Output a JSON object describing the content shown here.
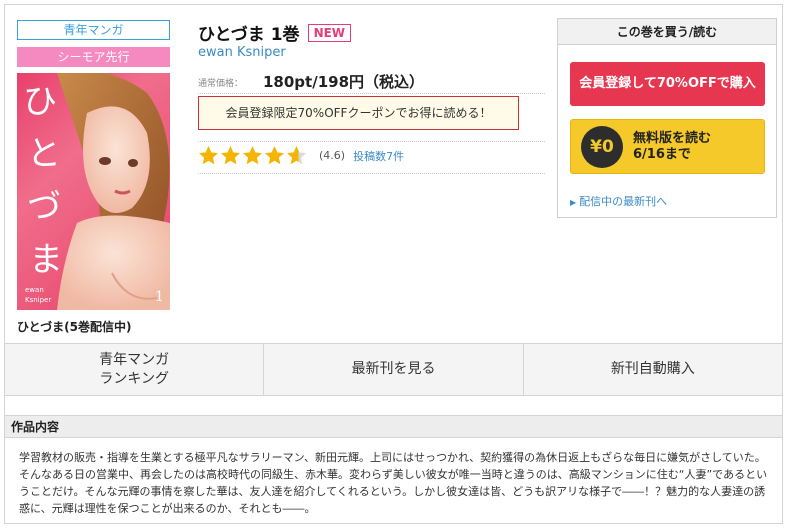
{
  "badges": {
    "genre": "青年マンガ",
    "sale": "シーモア先行"
  },
  "cover": {
    "author_credit_top": "ewan",
    "author_credit_bottom": "Ksniper",
    "volume_number": "1"
  },
  "series_label": "ひとづま(5巻配信中)",
  "book": {
    "title": "ひとづま 1巻",
    "new_badge": "NEW",
    "author": "ewan Ksniper",
    "price_label": "通常価格：",
    "price": "180pt/198円（税込）",
    "coupon": "会員登録限定70%OFFクーポンでお得に読める！",
    "rating": 4.6,
    "rating_text": "(4.6)",
    "review_count": "投稿数7件"
  },
  "buy_box": {
    "header": "この巻を買う/読む",
    "member_button": "会員登録して70%OFFで購入",
    "free_icon": "¥0",
    "free_line1": "無料版を読む",
    "free_line2": "6/16まで",
    "latest_link": "配信中の最新刊へ"
  },
  "actions": [
    {
      "label_line1": "青年マンガ",
      "label_line2": "ランキング"
    },
    {
      "label_line1": "最新刊を見る",
      "label_line2": ""
    },
    {
      "label_line1": "新刊自動購入",
      "label_line2": ""
    }
  ],
  "description": {
    "header": "作品内容",
    "text": "学習教材の販売・指導を生業とする極平凡なサラリーマン、新田元輝。上司にはせっつかれ、契約獲得の為休日返上もざらな毎日に嫌気がさしていた。そんなある日の営業中、再会したのは高校時代の同級生、赤木華。変わらず美しい彼女が唯一当時と違うのは、高級マンションに住む“人妻”であるということだけ。そんな元輝の事情を察した華は、友人達を紹介してくれるという。しかし彼女達は皆、どうも訳アリな様子で――！？魅力的な人妻達の誘惑に、元輝は理性を保つことが出来るのか、それとも――。"
  },
  "colors": {
    "accent_blue": "#3aa0d8",
    "link_blue": "#3a8bc8",
    "pink_badge": "#f58ac0",
    "buy_red": "#e7364f",
    "free_yellow": "#f5c92a",
    "star_yellow": "#f4b400"
  }
}
